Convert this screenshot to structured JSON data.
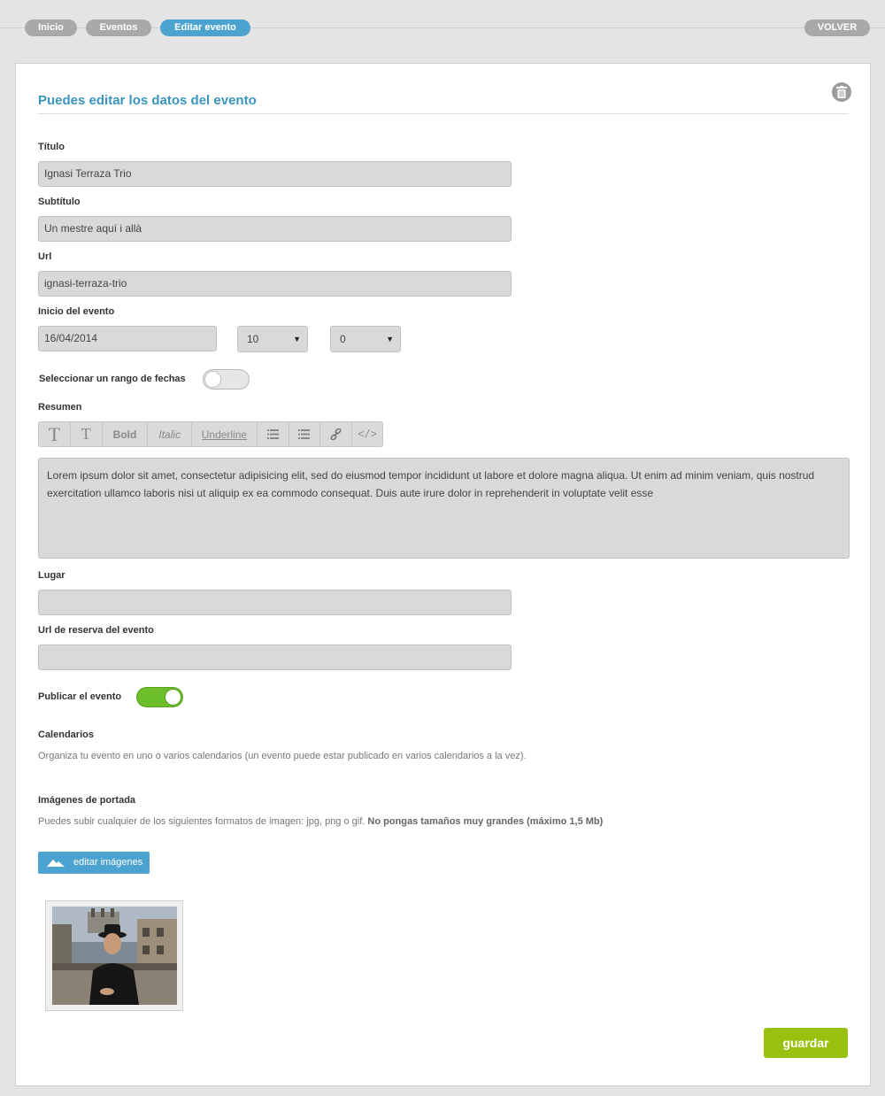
{
  "breadcrumb": {
    "items": [
      "Inicio",
      "Eventos",
      "Editar evento"
    ],
    "back_label": "VOLVER"
  },
  "form": {
    "heading": "Puedes editar los datos del evento",
    "title_label": "Título",
    "title_value": "Ignasi Terraza Trio",
    "subtitle_label": "Subtítulo",
    "subtitle_value": "Un mestre aquí i allà",
    "url_label": "Url",
    "url_value": "ignasi-terraza-trio",
    "start_label": "Inicio del evento",
    "start_date": "16/04/2014",
    "start_hour": "10",
    "start_minute": "0",
    "range_label": "Seleccionar un rango de fechas",
    "range_enabled": false,
    "summary_label": "Resumen",
    "toolbar": {
      "h1": "T",
      "h2": "T",
      "bold": "Bold",
      "italic": "Italic",
      "underline": "Underline",
      "code": "</>"
    },
    "summary_text": "Lorem ipsum dolor sit amet, consectetur adipisicing elit, sed do eiusmod tempor incididunt ut labore et dolore magna aliqua. Ut enim ad minim veniam, quis nostrud exercitation ullamco laboris nisi ut aliquip ex ea commodo consequat. Duis aute irure dolor in reprehenderit in voluptate velit esse",
    "place_label": "Lugar",
    "place_value": "",
    "booking_label": "Url de reserva del evento",
    "booking_value": "",
    "publish_label": "Publicar el evento",
    "publish_enabled": true,
    "calendars_label": "Calendarios",
    "calendars_help": "Organiza tu evento en uno o varios calendarios (un evento puede estar publicado en varios calendarios a la vez).",
    "images_label": "Imágenes de portada",
    "images_help": "Puedes subir cualquier de los siguientes formatos de imagen: jpg, png o gif.",
    "images_help_bold": "No pongas tamaños muy grandes (máximo 1,5 Mb)",
    "edit_images_button": "editar imágenes",
    "save_button": "guardar"
  },
  "colors": {
    "accent": "#4da3cf",
    "heading": "#3a94bd",
    "toggle_on": "#6cbf2a",
    "save": "#97c00f"
  }
}
